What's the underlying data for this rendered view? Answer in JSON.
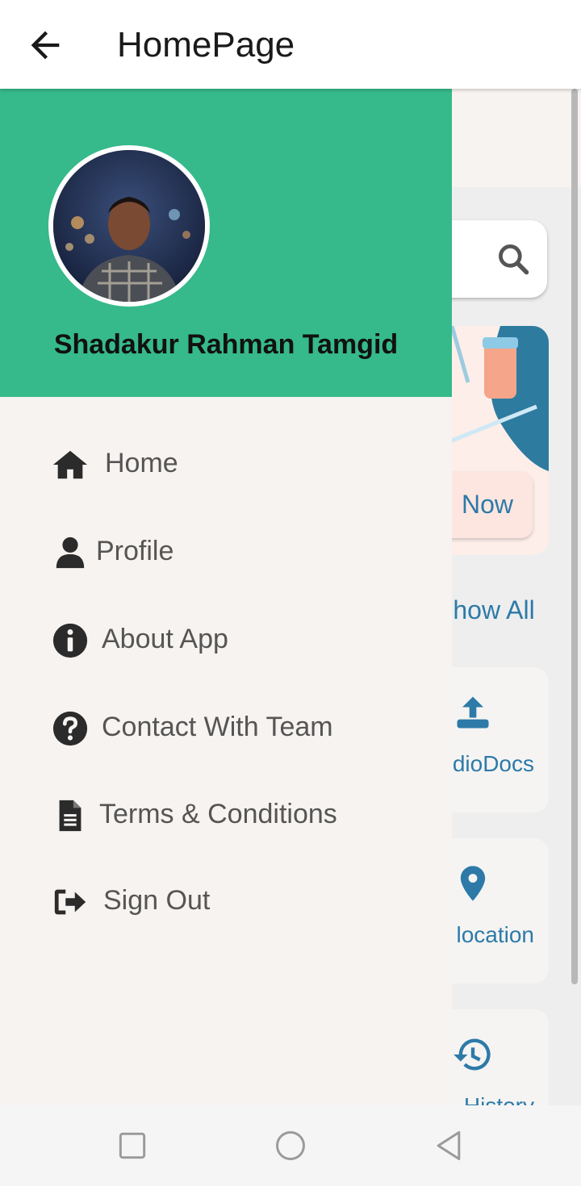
{
  "appbar": {
    "title": "HomePage"
  },
  "background": {
    "header_fragment": "0",
    "now_button": "Now",
    "show_all": "Show All",
    "cards": [
      {
        "label": "AudioDocs",
        "icon": "upload-icon"
      },
      {
        "label": "location",
        "icon": "location-pin-icon"
      },
      {
        "label": "History",
        "icon": "history-icon"
      }
    ]
  },
  "drawer": {
    "user_name": "Shadakur Rahman Tamgid",
    "items": [
      {
        "label": "Home",
        "icon": "home-icon"
      },
      {
        "label": "Profile",
        "icon": "user-icon"
      },
      {
        "label": "About App",
        "icon": "info-icon"
      },
      {
        "label": "Contact With Team",
        "icon": "help-icon"
      },
      {
        "label": "Terms & Conditions",
        "icon": "document-icon"
      },
      {
        "label": "Sign Out",
        "icon": "sign-out-icon"
      }
    ]
  },
  "colors": {
    "drawer_header": "#36b98b",
    "accent_blue": "#2d7aa8",
    "drawer_bg": "#f7f3f0"
  }
}
